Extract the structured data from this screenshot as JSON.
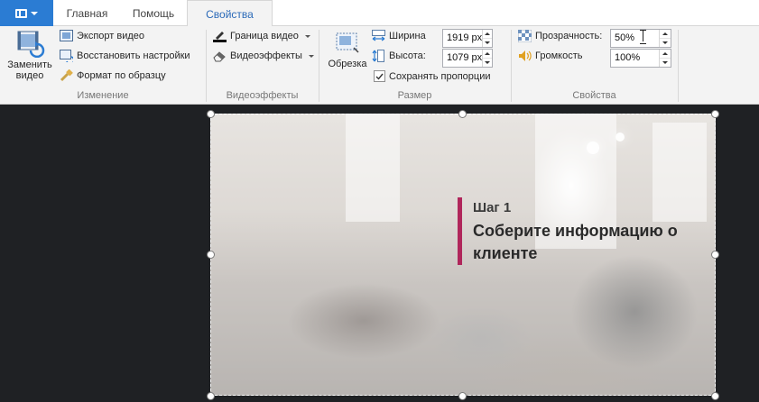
{
  "app_menu": {
    "icon": "film-strip-icon"
  },
  "tabs": [
    {
      "label": "Главная",
      "active": false
    },
    {
      "label": "Помощь",
      "active": false
    },
    {
      "label": "Свойства",
      "active": true
    }
  ],
  "groups": {
    "change": {
      "label": "Изменение",
      "replace_label_1": "Заменить",
      "replace_label_2": "видео",
      "export_label": "Экспорт видео",
      "restore_label": "Восстановить настройки",
      "format_painter_label": "Формат по образцу"
    },
    "effects": {
      "label": "Видеоэффекты",
      "border_label": "Граница видео",
      "effects_label": "Видеоэффекты"
    },
    "size": {
      "label": "Размер",
      "crop_label": "Обрезка",
      "width_label": "Ширина",
      "width_value": "1919 px",
      "height_label": "Высота:",
      "height_value": "1079 px",
      "keep_ratio_label": "Сохранять пропорции",
      "keep_ratio_checked": true
    },
    "props": {
      "label": "Свойства",
      "transparency_label": "Прозрачность:",
      "transparency_value": "50%",
      "volume_label": "Громкость",
      "volume_value": "100%"
    }
  },
  "slide": {
    "step": "Шаг 1",
    "headline": "Соберите информацию о клиенте",
    "accent_color": "#b0265b"
  },
  "colors": {
    "accent_blue": "#2b7cd3",
    "canvas_bg": "#1f2124",
    "ribbon_bg": "#f3f3f3"
  }
}
